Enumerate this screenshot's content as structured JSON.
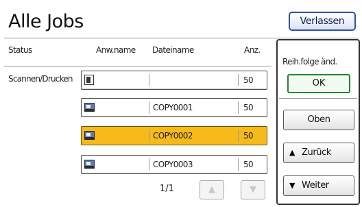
{
  "header": {
    "title": "Alle Jobs",
    "exit_label": "Verlassen"
  },
  "columns": {
    "status": "Status",
    "user_name": "Anw.name",
    "file_name": "Dateiname",
    "count": "Anz."
  },
  "status_value": "Scannen/Drucken",
  "jobs": [
    {
      "icon": "document-icon",
      "user": "",
      "file": "",
      "count": "50",
      "selected": false
    },
    {
      "icon": "copy-job-icon",
      "user": "",
      "file": "COPY0001",
      "count": "50",
      "selected": false
    },
    {
      "icon": "copy-job-icon",
      "user": "",
      "file": "COPY0002",
      "count": "50",
      "selected": true
    },
    {
      "icon": "copy-job-icon",
      "user": "",
      "file": "COPY0003",
      "count": "50",
      "selected": false
    }
  ],
  "pager": {
    "label": "1/1",
    "up_glyph": "▲",
    "down_glyph": "▼"
  },
  "side_panel": {
    "title": "Reih.folge änd.",
    "ok_label": "OK",
    "top_label": "Oben",
    "back_label": "Zurück",
    "back_glyph": "▲",
    "next_label": "Weiter",
    "next_glyph": "▼"
  },
  "colors": {
    "selected_row": "#f6ba1a",
    "ok_border": "#1e8a2c",
    "exit_border": "#2f4ea5"
  }
}
